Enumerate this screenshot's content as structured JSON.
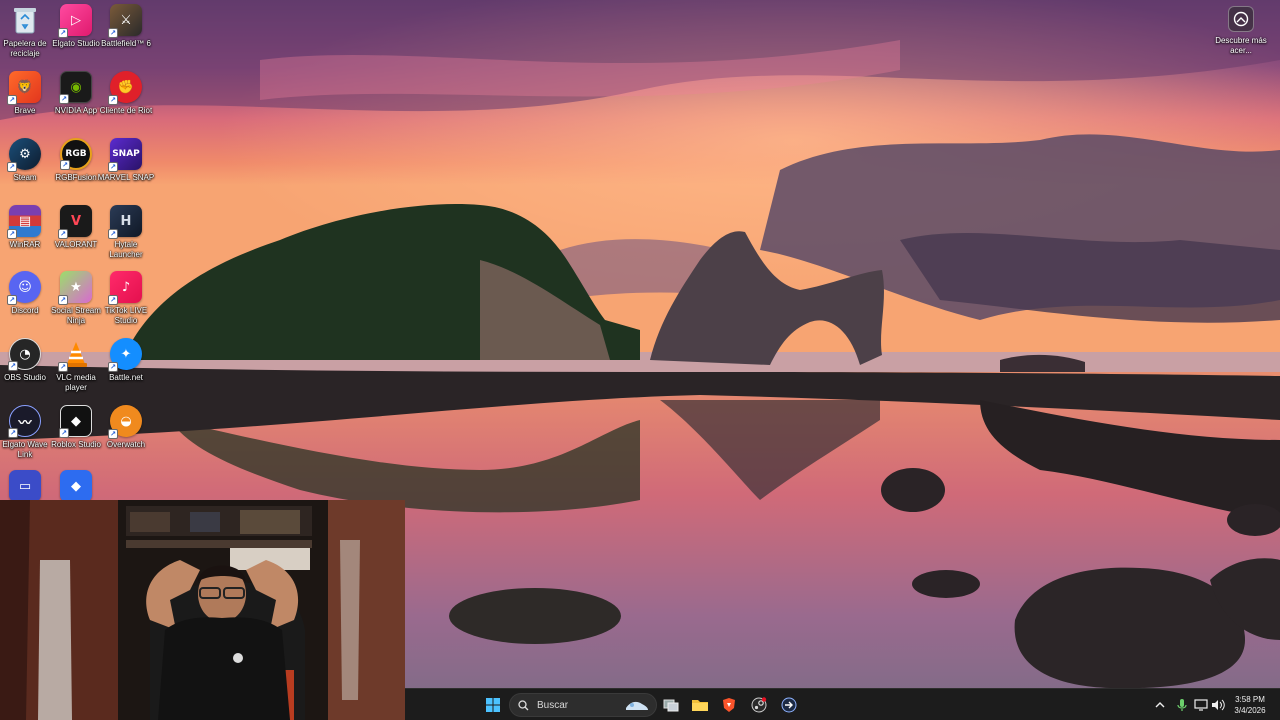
{
  "desktop": {
    "icons": [
      {
        "label": "Papelera de reciclaje",
        "icon": "recycle-bin-icon"
      },
      {
        "label": "Elgato Studio",
        "icon": "elgato-studio-icon"
      },
      {
        "label": "Battlefield™ 6",
        "icon": "battlefield-icon"
      },
      {
        "label": "Brave",
        "icon": "brave-icon"
      },
      {
        "label": "NVIDIA App",
        "icon": "nvidia-icon"
      },
      {
        "label": "Cliente de Riot",
        "icon": "riot-icon"
      },
      {
        "label": "Steam",
        "icon": "steam-icon"
      },
      {
        "label": "RGBFusion",
        "icon": "rgbfusion-icon"
      },
      {
        "label": "MARVEL SNAP",
        "icon": "marvel-snap-icon"
      },
      {
        "label": "WinRAR",
        "icon": "winrar-icon"
      },
      {
        "label": "VALORANT",
        "icon": "valorant-icon"
      },
      {
        "label": "Hytale Launcher",
        "icon": "hytale-icon"
      },
      {
        "label": "Discord",
        "icon": "discord-icon"
      },
      {
        "label": "Social Stream Ninja",
        "icon": "social-stream-ninja-icon"
      },
      {
        "label": "TikTok LIVE Studio",
        "icon": "tiktok-live-icon"
      },
      {
        "label": "OBS Studio",
        "icon": "obs-icon"
      },
      {
        "label": "VLC media player",
        "icon": "vlc-icon"
      },
      {
        "label": "Battle.net",
        "icon": "battlenet-icon"
      },
      {
        "label": "Elgato Wave Link",
        "icon": "wave-link-icon"
      },
      {
        "label": "Roblox Studio",
        "icon": "roblox-studio-icon"
      },
      {
        "label": "Overwatch",
        "icon": "overwatch-icon"
      }
    ],
    "widget": {
      "label": "Descubre más acer..."
    }
  },
  "taskbar": {
    "search_placeholder": "Buscar",
    "clock_time": "3:58 PM",
    "clock_date": "3/4/2026"
  },
  "colors": {
    "taskbar_bg": "#1c1c1c",
    "accent": "#0078d4"
  }
}
